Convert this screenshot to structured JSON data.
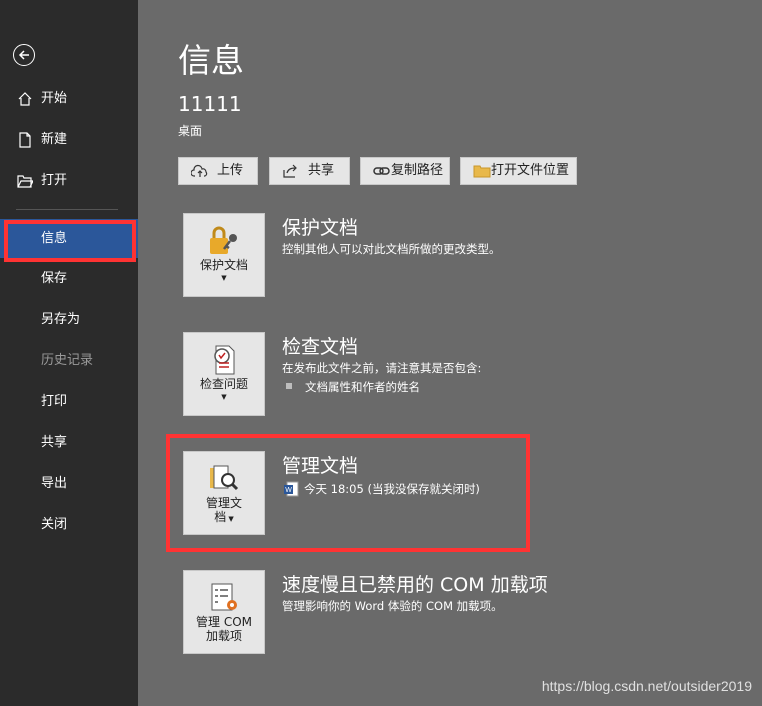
{
  "sidebar": {
    "back_icon": "back-arrow-icon",
    "items": [
      {
        "label": "开始",
        "icon": "home-icon"
      },
      {
        "label": "新建",
        "icon": "new-document-icon"
      },
      {
        "label": "打开",
        "icon": "open-folder-icon"
      },
      {
        "label": "信息"
      },
      {
        "label": "保存"
      },
      {
        "label": "另存为"
      },
      {
        "label": "历史记录"
      },
      {
        "label": "打印"
      },
      {
        "label": "共享"
      },
      {
        "label": "导出"
      },
      {
        "label": "关闭"
      }
    ],
    "active_color": "#2b579a"
  },
  "main": {
    "title": "信息",
    "doc_name": "11111",
    "doc_location": "桌面",
    "buttons": [
      {
        "label": "上传",
        "icon": "cloud-upload-icon"
      },
      {
        "label": "共享",
        "icon": "share-icon"
      },
      {
        "label": "复制路径",
        "icon": "link-icon"
      },
      {
        "label": "打开文件位置",
        "icon": "folder-icon"
      }
    ],
    "sections": [
      {
        "button_label": "保护文档",
        "title": "保护文档",
        "desc": "控制其他人可以对此文档所做的更改类型。",
        "icon": "lock-key-icon"
      },
      {
        "button_label": "检查问题",
        "title": "检查文档",
        "desc": "在发布此文件之前，请注意其是否包含:",
        "bullets": [
          "文档属性和作者的姓名"
        ],
        "icon": "inspect-document-icon"
      },
      {
        "button_label_1": "管理文",
        "button_label_2": "档",
        "title": "管理文档",
        "desc": "今天 18:05 (当我没保存就关闭时)",
        "icon": "manage-document-icon",
        "file_icon": "word-file-icon"
      },
      {
        "button_label_1": "管理 COM",
        "button_label_2": "加载项",
        "title": "速度慢且已禁用的 COM 加载项",
        "desc": "管理影响你的 Word 体验的 COM 加载项。",
        "icon": "com-addins-icon"
      }
    ]
  },
  "highlight_color": "#ff3333",
  "watermark": "https://blog.csdn.net/outsider2019"
}
